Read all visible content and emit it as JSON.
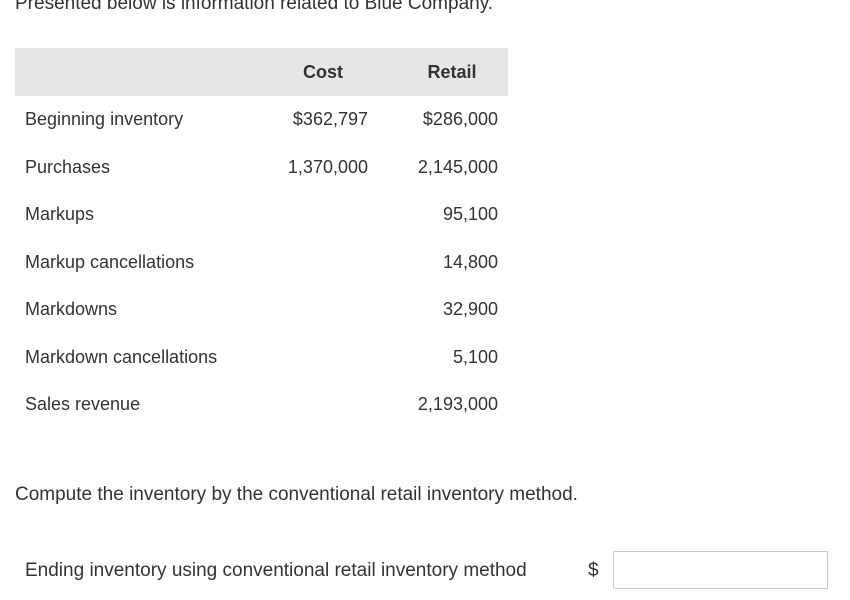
{
  "intro_text": "Presented below is information related to Blue Company.",
  "table": {
    "headers": {
      "label": "",
      "cost": "Cost",
      "retail": "Retail"
    },
    "rows": [
      {
        "label": "Beginning inventory",
        "cost": "$362,797",
        "retail": "$286,000"
      },
      {
        "label": "Purchases",
        "cost": "1,370,000",
        "retail": "2,145,000"
      },
      {
        "label": "Markups",
        "cost": "",
        "retail": "95,100"
      },
      {
        "label": "Markup cancellations",
        "cost": "",
        "retail": "14,800"
      },
      {
        "label": "Markdowns",
        "cost": "",
        "retail": "32,900"
      },
      {
        "label": "Markdown cancellations",
        "cost": "",
        "retail": "5,100"
      },
      {
        "label": "Sales revenue",
        "cost": "",
        "retail": "2,193,000"
      }
    ]
  },
  "question": "Compute the inventory by the conventional retail inventory method.",
  "answer": {
    "label": "Ending inventory using conventional retail inventory method",
    "currency_symbol": "$",
    "value": ""
  },
  "colors": {
    "header_bg": "#e6e6e6",
    "text": "#333333",
    "input_border": "#c8c8c8"
  }
}
